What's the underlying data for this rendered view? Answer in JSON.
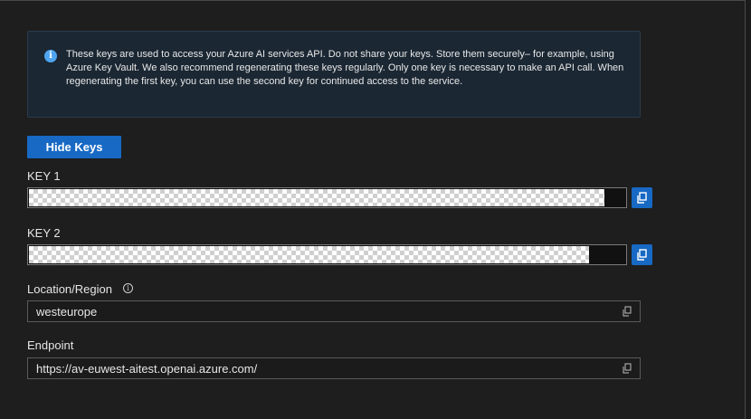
{
  "info": {
    "icon": "info-icon",
    "message": "These keys are used to access your Azure AI services API. Do not share your keys. Store them securely– for example, using Azure Key Vault. We also recommend regenerating these keys regularly. Only one key is necessary to make an API call. When regenerating the first key, you can use the second key for continued access to the service."
  },
  "hide_keys_label": "Hide Keys",
  "key1": {
    "label": "KEY 1",
    "value": ""
  },
  "key2": {
    "label": "KEY 2",
    "value": ""
  },
  "location": {
    "label": "Location/Region",
    "value": "westeurope"
  },
  "endpoint": {
    "label": "Endpoint",
    "value": "https://av-euwest-aitest.openai.azure.com/"
  },
  "colors": {
    "accent": "#1769c4",
    "info_bg": "#1b2733",
    "background": "#1e1e1e"
  }
}
